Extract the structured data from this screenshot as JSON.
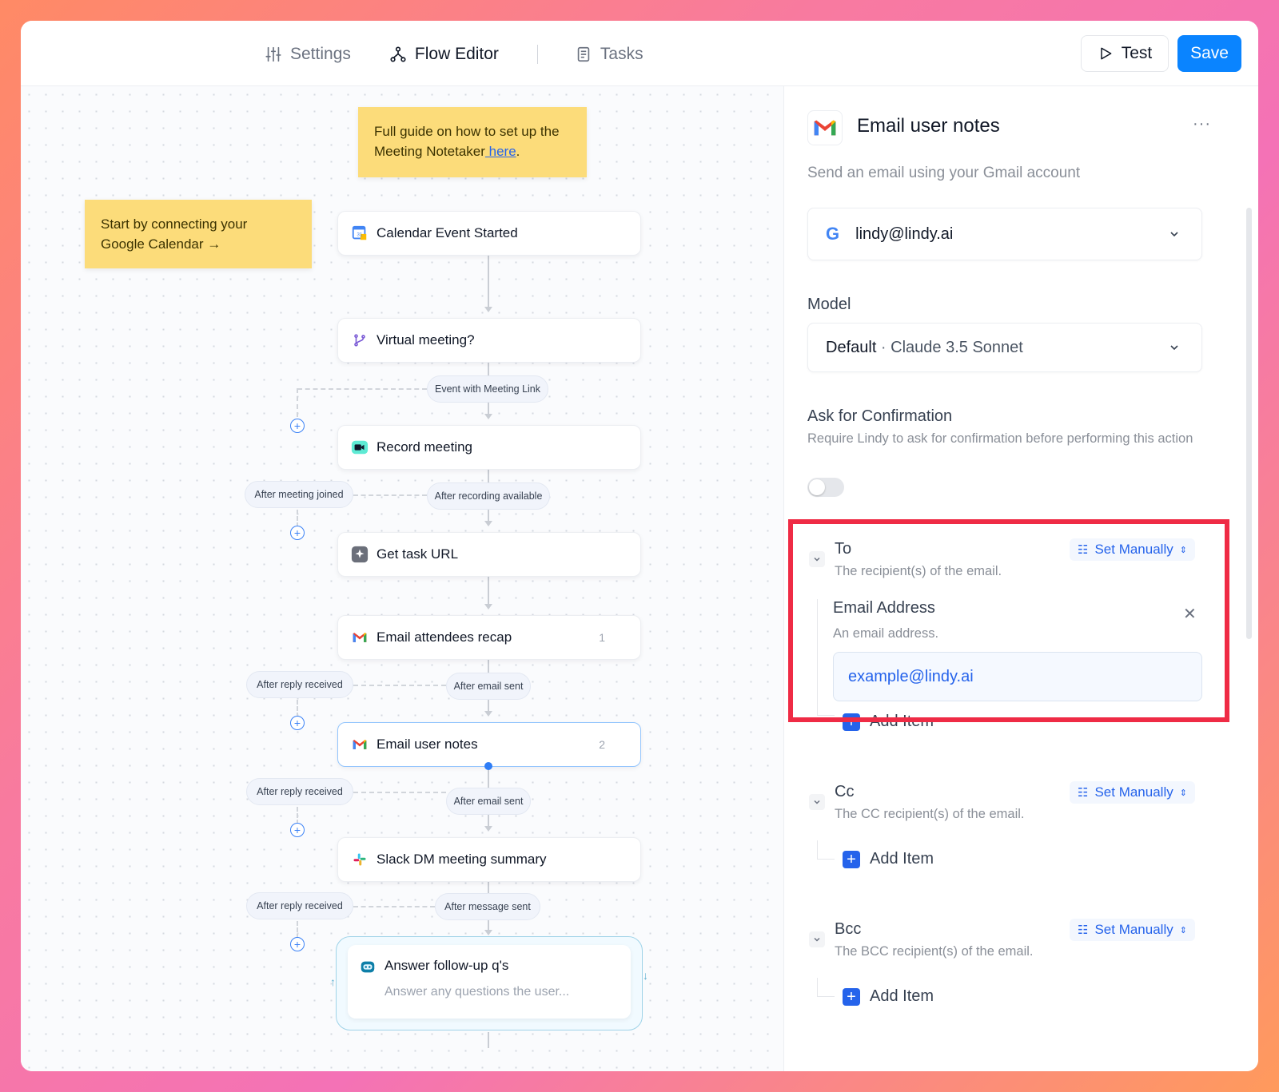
{
  "topbar": {
    "tabs": [
      {
        "label": "Settings",
        "icon": "sliders-icon"
      },
      {
        "label": "Flow Editor",
        "icon": "flow-icon",
        "active": true
      },
      {
        "label": "Tasks",
        "icon": "document-icon"
      }
    ],
    "test_label": "Test",
    "save_label": "Save"
  },
  "canvas": {
    "sticky_guide_text": "Full guide on how to set up the Meeting Notetaker",
    "sticky_guide_link": " here",
    "sticky_guide_end": ".",
    "sticky_start_line1": "Start by connecting your",
    "sticky_start_line2": "Google Calendar →",
    "nodes": [
      {
        "label": "Calendar Event Started",
        "icon": "google-calendar-icon"
      },
      {
        "label": "Virtual meeting?",
        "icon": "branch-icon"
      },
      {
        "label": "Record meeting",
        "icon": "video-icon"
      },
      {
        "label": "Get task URL",
        "icon": "sparkle-icon"
      },
      {
        "label": "Email attendees recap",
        "icon": "gmail-icon",
        "count": "1"
      },
      {
        "label": "Email user notes",
        "icon": "gmail-icon",
        "count": "2"
      },
      {
        "label": "Slack DM meeting summary",
        "icon": "slack-icon"
      }
    ],
    "pills": {
      "event_link": "Event with Meeting Link",
      "after_joined": "After meeting joined",
      "after_recording": "After recording available",
      "after_reply_1": "After reply received",
      "after_email_1": "After email sent",
      "after_reply_2": "After reply received",
      "after_email_2": "After email sent",
      "after_reply_3": "After reply received",
      "after_message": "After message sent"
    },
    "loop": {
      "title": "Answer follow-up q's",
      "subtitle": "Answer any questions the user..."
    }
  },
  "panel": {
    "title": "Email user notes",
    "more": "···",
    "description": "Send an email using your Gmail account",
    "account": "lindy@lindy.ai",
    "model_label": "Model",
    "model_default": "Default",
    "model_sep": " · ",
    "model_name": "Claude 3.5 Sonnet",
    "confirm_title": "Ask for Confirmation",
    "confirm_desc": "Require Lindy to ask for confirmation before performing this action",
    "confirm_enabled": false,
    "set_manually": "Set Manually",
    "to": {
      "title": "To",
      "desc": "The recipient(s) of the email.",
      "email_label": "Email Address",
      "email_desc": "An email address.",
      "email_value": "example@lindy.ai",
      "add_item": "Add Item"
    },
    "cc": {
      "title": "Cc",
      "desc": "The CC recipient(s) of the email.",
      "add_item": "Add Item"
    },
    "bcc": {
      "title": "Bcc",
      "desc": "The BCC recipient(s) of the email.",
      "add_item": "Add Item"
    }
  },
  "colors": {
    "accent": "#0a84ff",
    "highlight": "#ef2b45",
    "sticky": "#fcdc7a"
  }
}
